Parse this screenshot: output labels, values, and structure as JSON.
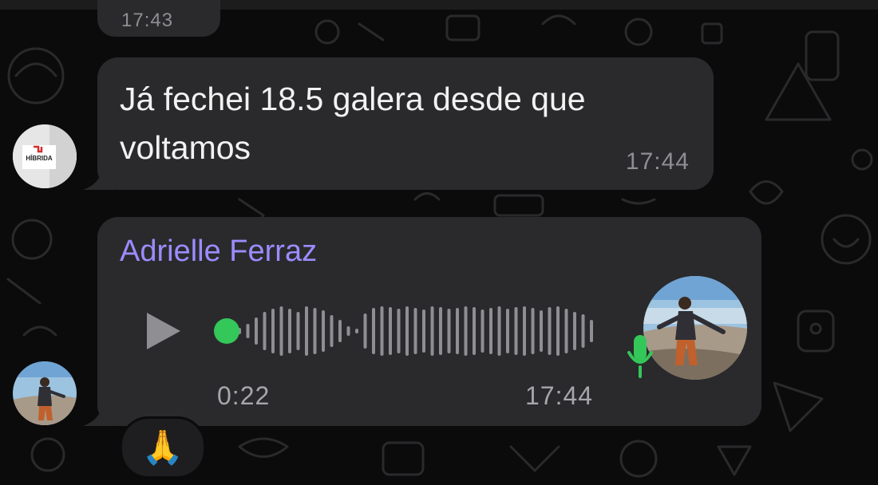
{
  "chat": {
    "previous_message": {
      "time": "17:43"
    },
    "message1": {
      "text": "Já fechei 18.5 galera desde que voltamos",
      "time": "17:44",
      "avatar": {
        "icon": "hibrida-logo-avatar",
        "logo_text": "HÍBRIDA"
      }
    },
    "message2": {
      "sender": "Adrielle Ferraz",
      "type": "voice",
      "duration": "0:22",
      "time": "17:44",
      "progress": 0,
      "icons": [
        "play-icon",
        "microphone-icon"
      ],
      "reaction": "🙏"
    }
  },
  "colors": {
    "background": "#0b0b0c",
    "bubble": "#2a2a2c",
    "sender_name": "#9b8cff",
    "voice_accent": "#34c759",
    "meta_text": "#8e8e93"
  }
}
